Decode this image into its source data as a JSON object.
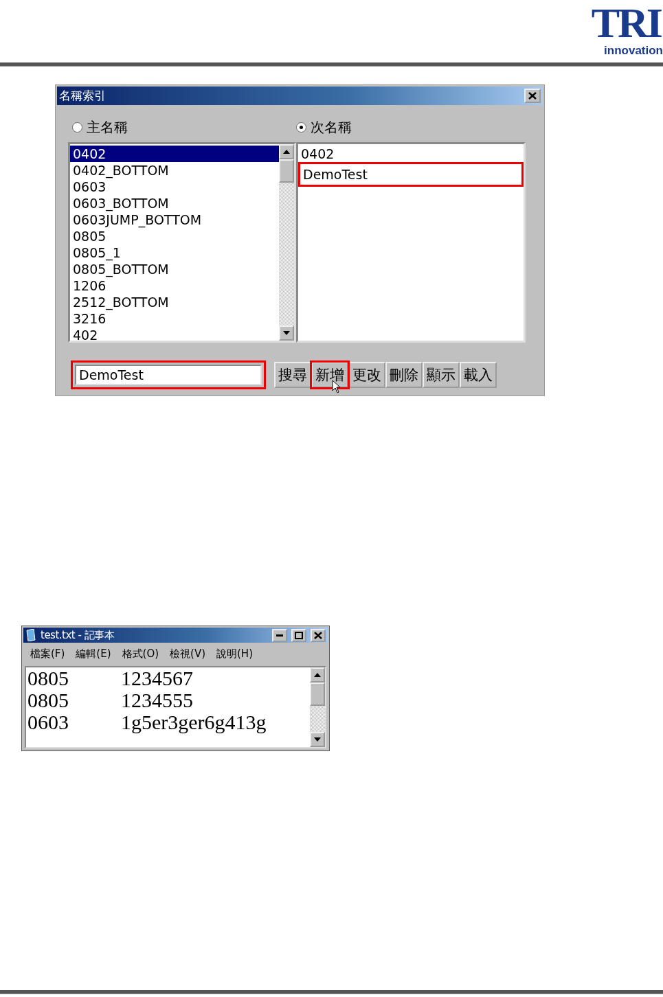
{
  "header": {
    "logo": {
      "mark": "TRI",
      "tagline": "innovation"
    }
  },
  "dialog": {
    "title": "名稱索引",
    "radios": [
      {
        "label": "主名稱",
        "selected": false
      },
      {
        "label": "次名稱",
        "selected": true
      }
    ],
    "primary_list": {
      "items": [
        {
          "label": "0402",
          "selected": true
        },
        {
          "label": "0402_BOTTOM",
          "selected": false
        },
        {
          "label": "0603",
          "selected": false
        },
        {
          "label": "0603_BOTTOM",
          "selected": false
        },
        {
          "label": "0603JUMP_BOTTOM",
          "selected": false
        },
        {
          "label": "0805",
          "selected": false
        },
        {
          "label": "0805_1",
          "selected": false
        },
        {
          "label": "0805_BOTTOM",
          "selected": false
        },
        {
          "label": "1206",
          "selected": false
        },
        {
          "label": "2512_BOTTOM",
          "selected": false
        },
        {
          "label": "3216",
          "selected": false
        },
        {
          "label": "402",
          "selected": false
        }
      ]
    },
    "secondary_list": {
      "items": [
        {
          "label": "0402",
          "selected": false,
          "highlighted": false
        },
        {
          "label": "DemoTest",
          "selected": false,
          "highlighted": true
        }
      ]
    },
    "name_field": {
      "value": "DemoTest",
      "highlighted": true
    },
    "buttons": [
      {
        "label": "搜尋",
        "highlighted": false,
        "hovered": false
      },
      {
        "label": "新增",
        "highlighted": true,
        "hovered": true
      },
      {
        "label": "更改",
        "highlighted": false,
        "hovered": false
      },
      {
        "label": "刪除",
        "highlighted": false,
        "hovered": false
      },
      {
        "label": "顯示",
        "highlighted": false,
        "hovered": false
      },
      {
        "label": "載入",
        "highlighted": false,
        "hovered": false
      }
    ]
  },
  "notepad": {
    "title": "test.txt - 記事本",
    "menu": [
      "檔案(F)",
      "編輯(E)",
      "格式(O)",
      "檢視(V)",
      "說明(H)"
    ],
    "lines": [
      {
        "column_1": "0805",
        "column_2": "1234567"
      },
      {
        "column_1": "0805",
        "column_2": "1234555"
      },
      {
        "column_1": "0603",
        "column_2": "1g5er3ger6g413g"
      }
    ]
  }
}
